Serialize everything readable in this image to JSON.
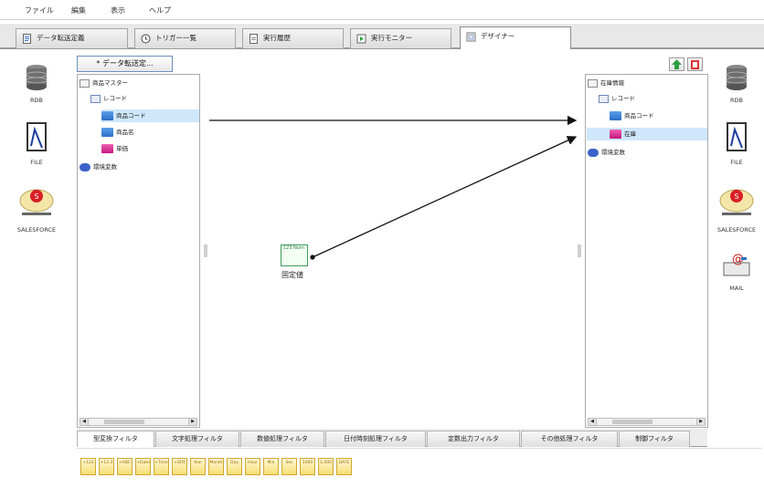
{
  "menu": [
    "ファイル",
    "編集",
    "表示",
    "ヘルプ"
  ],
  "tabs": [
    {
      "label": "データ転送定義",
      "active": false
    },
    {
      "label": "トリガー一覧",
      "active": false
    },
    {
      "label": "実行履歴",
      "active": false
    },
    {
      "label": "実行モニター",
      "active": false
    },
    {
      "label": "デザイナー",
      "active": true
    }
  ],
  "left_palette": [
    "RDB",
    "FILE",
    "SALESFORCE"
  ],
  "right_palette": [
    "RDB",
    "FILE",
    "SALESFORCE",
    "MAIL"
  ],
  "transfer_button": "* データ転送定...",
  "source_tree": {
    "root": "商品マスター",
    "record": "レコード",
    "fields": [
      "商品コード",
      "商品名",
      "単価"
    ],
    "env": "環境変数"
  },
  "target_tree": {
    "root": "在庫情報",
    "record": "レコード",
    "fields": [
      "商品コード",
      "在庫"
    ],
    "env": "環境変数"
  },
  "node": {
    "label": "固定値",
    "icon_text": "123 Num"
  },
  "filter_tabs": [
    "型変換フィルタ",
    "文字処理フィルタ",
    "数値処理フィルタ",
    "日付時刻処理フィルタ",
    "定数出力フィルタ",
    "その他処理フィルタ",
    "制御フィルタ"
  ],
  "filter_icons": [
    "+123",
    "+12.3",
    "+ABC",
    "+Date",
    "+Time",
    "+日付",
    "Year",
    "Month",
    "Day",
    "Hour",
    "Min",
    "Sec",
    "1000",
    "1,000",
    "DATE"
  ]
}
